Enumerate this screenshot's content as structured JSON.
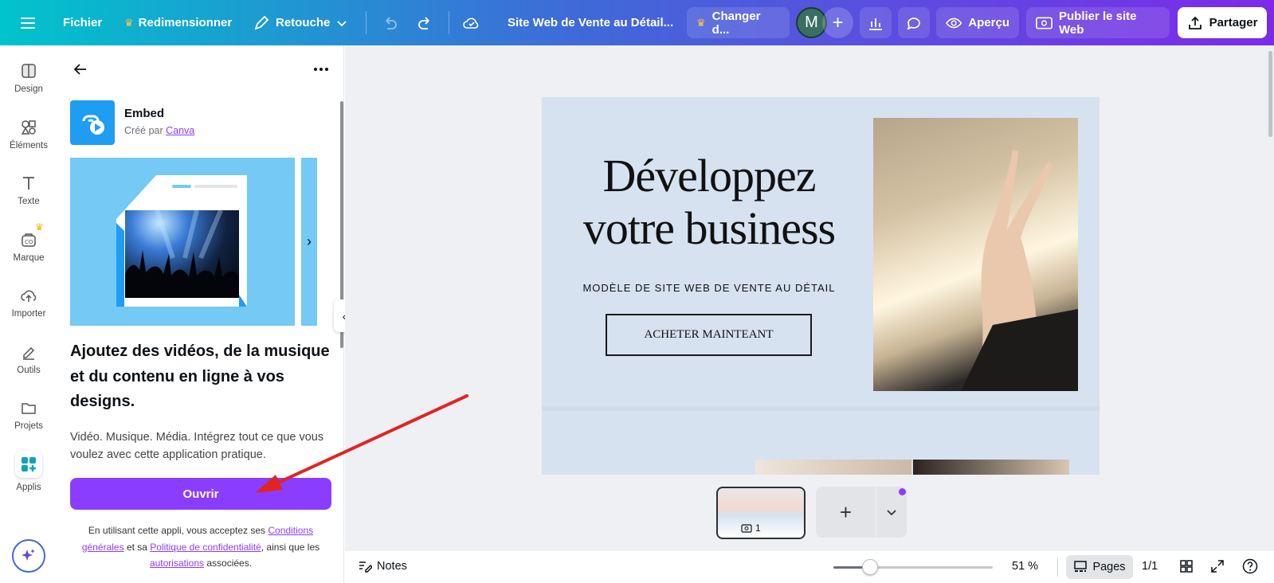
{
  "topbar": {
    "menu_icon": "hamburger-icon",
    "file": "Fichier",
    "resize": "Redimensionner",
    "retouch": "Retouche",
    "doc_title": "Site Web de Vente au Détail...",
    "change": "Changer d...",
    "avatar_letter": "M",
    "preview": "Aperçu",
    "publish": "Publier le site Web",
    "share": "Partager"
  },
  "rail": {
    "items": [
      {
        "label": "Design",
        "icon": "layout-icon"
      },
      {
        "label": "Éléments",
        "icon": "shapes-icon"
      },
      {
        "label": "Texte",
        "icon": "text-icon"
      },
      {
        "label": "Marque",
        "icon": "brand-icon"
      },
      {
        "label": "Importer",
        "icon": "cloud-upload-icon"
      },
      {
        "label": "Outils",
        "icon": "pen-tool-icon"
      },
      {
        "label": "Projets",
        "icon": "folder-icon"
      },
      {
        "label": "Applis",
        "icon": "apps-icon"
      }
    ]
  },
  "panel": {
    "app_name": "Embed",
    "created_by": "Créé par",
    "creator": "Canva",
    "headline": "Ajoutez des vidéos, de la musique et du contenu en ligne à vos designs.",
    "description": "Vidéo. Musique. Média. Intégrez tout ce que vous voulez avec cette application pratique.",
    "open_button": "Ouvrir",
    "terms_1": "En utilisant cette appli, vous acceptez ses",
    "terms_link_1": "Conditions générales",
    "terms_2": "et sa",
    "terms_link_2": "Politique de confidentialité",
    "terms_3": ", ainsi que les",
    "terms_link_3": "autorisations",
    "terms_4": "associées."
  },
  "canvas": {
    "title": "Développez votre business",
    "subtitle": "MODÈLE DE SITE WEB DE VENTE AU DÉTAIL",
    "cta": "ACHETER MAINTEANT"
  },
  "pages": {
    "thumb_number": "1"
  },
  "bottombar": {
    "notes": "Notes",
    "zoom_value": 51,
    "zoom": "51 %",
    "pages": "Pages",
    "page_count": "1/1"
  },
  "colors": {
    "accent": "#8b3dff",
    "gradient_start": "#00c4cc",
    "gradient_end": "#7d2ae8",
    "annotation_arrow": "#e02424"
  }
}
